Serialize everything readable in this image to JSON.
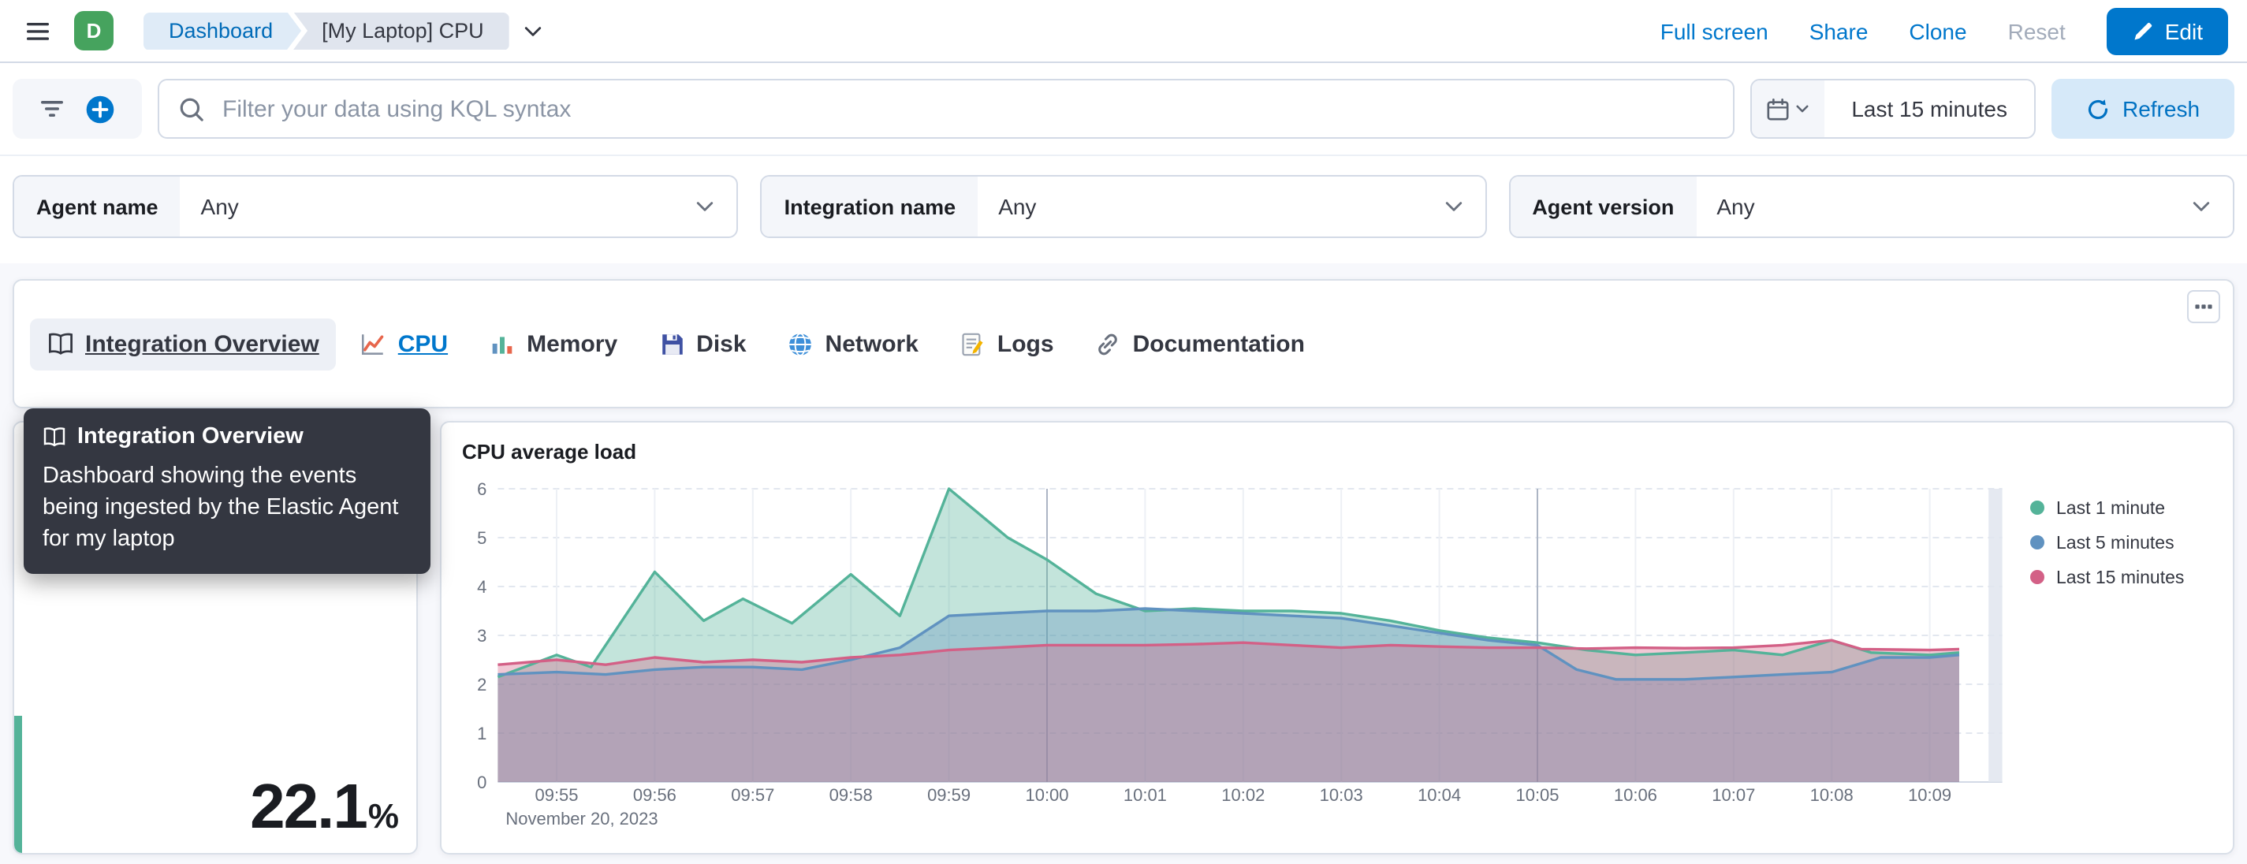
{
  "header": {
    "avatar_initial": "D",
    "breadcrumbs": [
      "Dashboard",
      "[My Laptop] CPU"
    ],
    "actions": {
      "full_screen": "Full screen",
      "share": "Share",
      "clone": "Clone",
      "reset": "Reset",
      "edit": "Edit"
    }
  },
  "query_bar": {
    "search_placeholder": "Filter your data using KQL syntax",
    "time_range": "Last 15 minutes",
    "refresh_label": "Refresh"
  },
  "controls": [
    {
      "label": "Agent name",
      "value": "Any"
    },
    {
      "label": "Integration name",
      "value": "Any"
    },
    {
      "label": "Agent version",
      "value": "Any"
    }
  ],
  "nav_links": [
    {
      "label": "Integration Overview",
      "icon": "book-icon",
      "state": "hover"
    },
    {
      "label": "CPU",
      "icon": "line-chart-icon",
      "state": "active"
    },
    {
      "label": "Memory",
      "icon": "bar-chart-icon",
      "state": "default"
    },
    {
      "label": "Disk",
      "icon": "floppy-disk-icon",
      "state": "default"
    },
    {
      "label": "Network",
      "icon": "globe-icon",
      "state": "default"
    },
    {
      "label": "Logs",
      "icon": "memo-icon",
      "state": "default"
    },
    {
      "label": "Documentation",
      "icon": "link-icon",
      "state": "default"
    }
  ],
  "tooltip": {
    "title": "Integration Overview",
    "body": "Dashboard showing the events being ingested by the Elastic Agent for my laptop"
  },
  "metric": {
    "value": "22.1",
    "unit": "%",
    "accent_color": "#54B399"
  },
  "chart_panel": {
    "title": "CPU average load"
  },
  "chart_data": {
    "type": "area",
    "title": "CPU average load",
    "x_context_label": "November 20, 2023",
    "x_tick_labels": [
      "09:55",
      "09:56",
      "09:57",
      "09:58",
      "09:59",
      "10:00",
      "10:01",
      "10:02",
      "10:03",
      "10:04",
      "10:05",
      "10:06",
      "10:07",
      "10:08",
      "10:09"
    ],
    "highlight_gridlines": [
      "10:00",
      "10:05"
    ],
    "ylim": [
      0,
      6
    ],
    "y_ticks": [
      0,
      1,
      2,
      3,
      4,
      5,
      6
    ],
    "grid": true,
    "legend_position": "right",
    "x_unit": "minutes after 09:55",
    "series": [
      {
        "name": "Last 1 minute",
        "color": "#54B399",
        "points": [
          [
            -0.6,
            2.15
          ],
          [
            0,
            2.6
          ],
          [
            0.35,
            2.35
          ],
          [
            1,
            4.3
          ],
          [
            1.5,
            3.3
          ],
          [
            1.9,
            3.75
          ],
          [
            2.4,
            3.25
          ],
          [
            3,
            4.25
          ],
          [
            3.5,
            3.4
          ],
          [
            4,
            6.0
          ],
          [
            4.6,
            5.0
          ],
          [
            5,
            4.55
          ],
          [
            5.5,
            3.85
          ],
          [
            6,
            3.5
          ],
          [
            6.5,
            3.55
          ],
          [
            7,
            3.5
          ],
          [
            7.5,
            3.5
          ],
          [
            8,
            3.45
          ],
          [
            8.5,
            3.3
          ],
          [
            9,
            3.1
          ],
          [
            9.5,
            2.95
          ],
          [
            10,
            2.85
          ],
          [
            10.5,
            2.7
          ],
          [
            11,
            2.6
          ],
          [
            11.5,
            2.65
          ],
          [
            12,
            2.7
          ],
          [
            12.5,
            2.6
          ],
          [
            13,
            2.9
          ],
          [
            13.4,
            2.65
          ],
          [
            14,
            2.6
          ],
          [
            14.3,
            2.65
          ]
        ]
      },
      {
        "name": "Last 5 minutes",
        "color": "#6092C0",
        "points": [
          [
            -0.6,
            2.2
          ],
          [
            0,
            2.25
          ],
          [
            0.5,
            2.2
          ],
          [
            1,
            2.3
          ],
          [
            1.5,
            2.35
          ],
          [
            2,
            2.35
          ],
          [
            2.5,
            2.3
          ],
          [
            3,
            2.5
          ],
          [
            3.5,
            2.75
          ],
          [
            4,
            3.4
          ],
          [
            4.5,
            3.45
          ],
          [
            5,
            3.5
          ],
          [
            5.5,
            3.5
          ],
          [
            6,
            3.55
          ],
          [
            6.5,
            3.5
          ],
          [
            7,
            3.45
          ],
          [
            7.5,
            3.4
          ],
          [
            8,
            3.35
          ],
          [
            8.5,
            3.2
          ],
          [
            9,
            3.05
          ],
          [
            9.5,
            2.9
          ],
          [
            10,
            2.8
          ],
          [
            10.4,
            2.3
          ],
          [
            10.8,
            2.1
          ],
          [
            11,
            2.1
          ],
          [
            11.5,
            2.1
          ],
          [
            12,
            2.15
          ],
          [
            12.5,
            2.2
          ],
          [
            13,
            2.25
          ],
          [
            13.5,
            2.55
          ],
          [
            14,
            2.55
          ],
          [
            14.3,
            2.6
          ]
        ]
      },
      {
        "name": "Last 15 minutes",
        "color": "#D36086",
        "points": [
          [
            -0.6,
            2.4
          ],
          [
            0,
            2.5
          ],
          [
            0.5,
            2.4
          ],
          [
            1,
            2.55
          ],
          [
            1.5,
            2.45
          ],
          [
            2,
            2.5
          ],
          [
            2.5,
            2.45
          ],
          [
            3,
            2.55
          ],
          [
            3.5,
            2.6
          ],
          [
            4,
            2.7
          ],
          [
            4.5,
            2.75
          ],
          [
            5,
            2.8
          ],
          [
            5.5,
            2.8
          ],
          [
            6,
            2.8
          ],
          [
            6.5,
            2.82
          ],
          [
            7,
            2.85
          ],
          [
            7.5,
            2.8
          ],
          [
            8,
            2.75
          ],
          [
            8.5,
            2.8
          ],
          [
            9,
            2.77
          ],
          [
            9.5,
            2.75
          ],
          [
            10,
            2.75
          ],
          [
            10.5,
            2.73
          ],
          [
            11,
            2.75
          ],
          [
            11.5,
            2.74
          ],
          [
            12,
            2.75
          ],
          [
            12.5,
            2.8
          ],
          [
            13,
            2.9
          ],
          [
            13.3,
            2.72
          ],
          [
            14,
            2.7
          ],
          [
            14.3,
            2.72
          ]
        ]
      }
    ]
  },
  "icons": {
    "hamburger-menu-icon": "three horizontal bars",
    "chevron-down-icon": "v chevron",
    "pencil-icon": "pencil glyph",
    "filter-funnel-icon": "funnel bars",
    "add-filter-icon": "plus in blue circle",
    "search-icon": "magnifier",
    "calendar-icon": "calendar grid",
    "refresh-icon": "circular arrow",
    "panel-options-icon": "three small squares",
    "book-icon": "open book",
    "line-chart-icon": "red trend line",
    "bar-chart-icon": "colored bars",
    "floppy-disk-icon": "blue floppy disk",
    "globe-icon": "blue globe",
    "memo-icon": "page with pencil",
    "link-icon": "chain link"
  }
}
